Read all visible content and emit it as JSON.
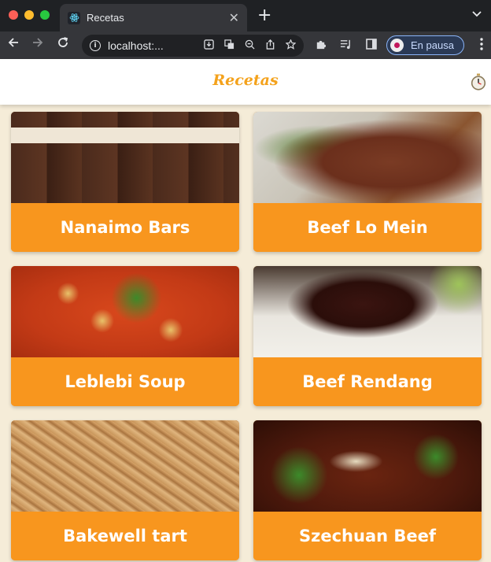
{
  "browser": {
    "tab_title": "Recetas",
    "tab_close": "✕",
    "new_tab": "+",
    "url": "localhost:...",
    "profile_status": "En pausa"
  },
  "app": {
    "title": "Recetas"
  },
  "recipes": [
    {
      "name": "Nanaimo Bars"
    },
    {
      "name": "Beef Lo Mein"
    },
    {
      "name": "Leblebi Soup"
    },
    {
      "name": "Beef Rendang"
    },
    {
      "name": "Bakewell tart"
    },
    {
      "name": "Szechuan Beef"
    }
  ],
  "colors": {
    "accent": "#f7941d",
    "title": "#f4a21c",
    "background": "#f5ecd8"
  },
  "icons": {
    "header_action": "stopwatch-icon"
  }
}
